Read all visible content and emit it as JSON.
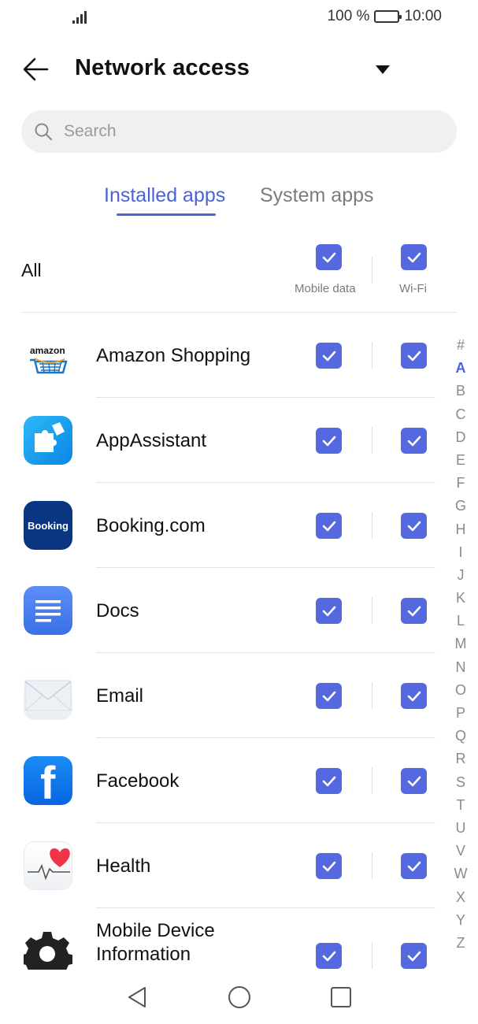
{
  "status_bar": {
    "battery": "100 %",
    "time": "10:00"
  },
  "header": {
    "title": "Network access"
  },
  "search": {
    "placeholder": "Search"
  },
  "tabs": [
    {
      "label": "Installed apps",
      "active": true
    },
    {
      "label": "System apps",
      "active": false
    }
  ],
  "all_row": {
    "label": "All",
    "mobile_data_label": "Mobile data",
    "wifi_label": "Wi-Fi",
    "mobile_data_checked": true,
    "wifi_checked": true
  },
  "apps": [
    {
      "name": "Amazon Shopping",
      "icon": "amazon-icon",
      "icon_text": "amazon",
      "mobile_data": true,
      "wifi": true
    },
    {
      "name": "AppAssistant",
      "icon": "app-assistant-icon",
      "mobile_data": true,
      "wifi": true
    },
    {
      "name": "Booking.com",
      "icon": "booking-icon",
      "icon_text": "Booking",
      "mobile_data": true,
      "wifi": true
    },
    {
      "name": "Docs",
      "icon": "docs-icon",
      "mobile_data": true,
      "wifi": true
    },
    {
      "name": "Email",
      "icon": "email-icon",
      "mobile_data": true,
      "wifi": true
    },
    {
      "name": "Facebook",
      "icon": "facebook-icon",
      "icon_text": "f",
      "mobile_data": true,
      "wifi": true
    },
    {
      "name": "Health",
      "icon": "health-icon",
      "mobile_data": true,
      "wifi": true
    },
    {
      "name_line1": "Mobile Device",
      "name_line2": "Information",
      "icon": "gear-icon",
      "mobile_data": true,
      "wifi": true
    }
  ],
  "index_letters": [
    "#",
    "A",
    "B",
    "C",
    "D",
    "E",
    "F",
    "G",
    "H",
    "I",
    "J",
    "K",
    "L",
    "M",
    "N",
    "O",
    "P",
    "Q",
    "R",
    "S",
    "T",
    "U",
    "V",
    "W",
    "X",
    "Y",
    "Z"
  ],
  "index_active": "A",
  "colors": {
    "accent": "#4a63d8",
    "checkbox": "#5468e0",
    "search_bg": "#f0f0f0"
  }
}
